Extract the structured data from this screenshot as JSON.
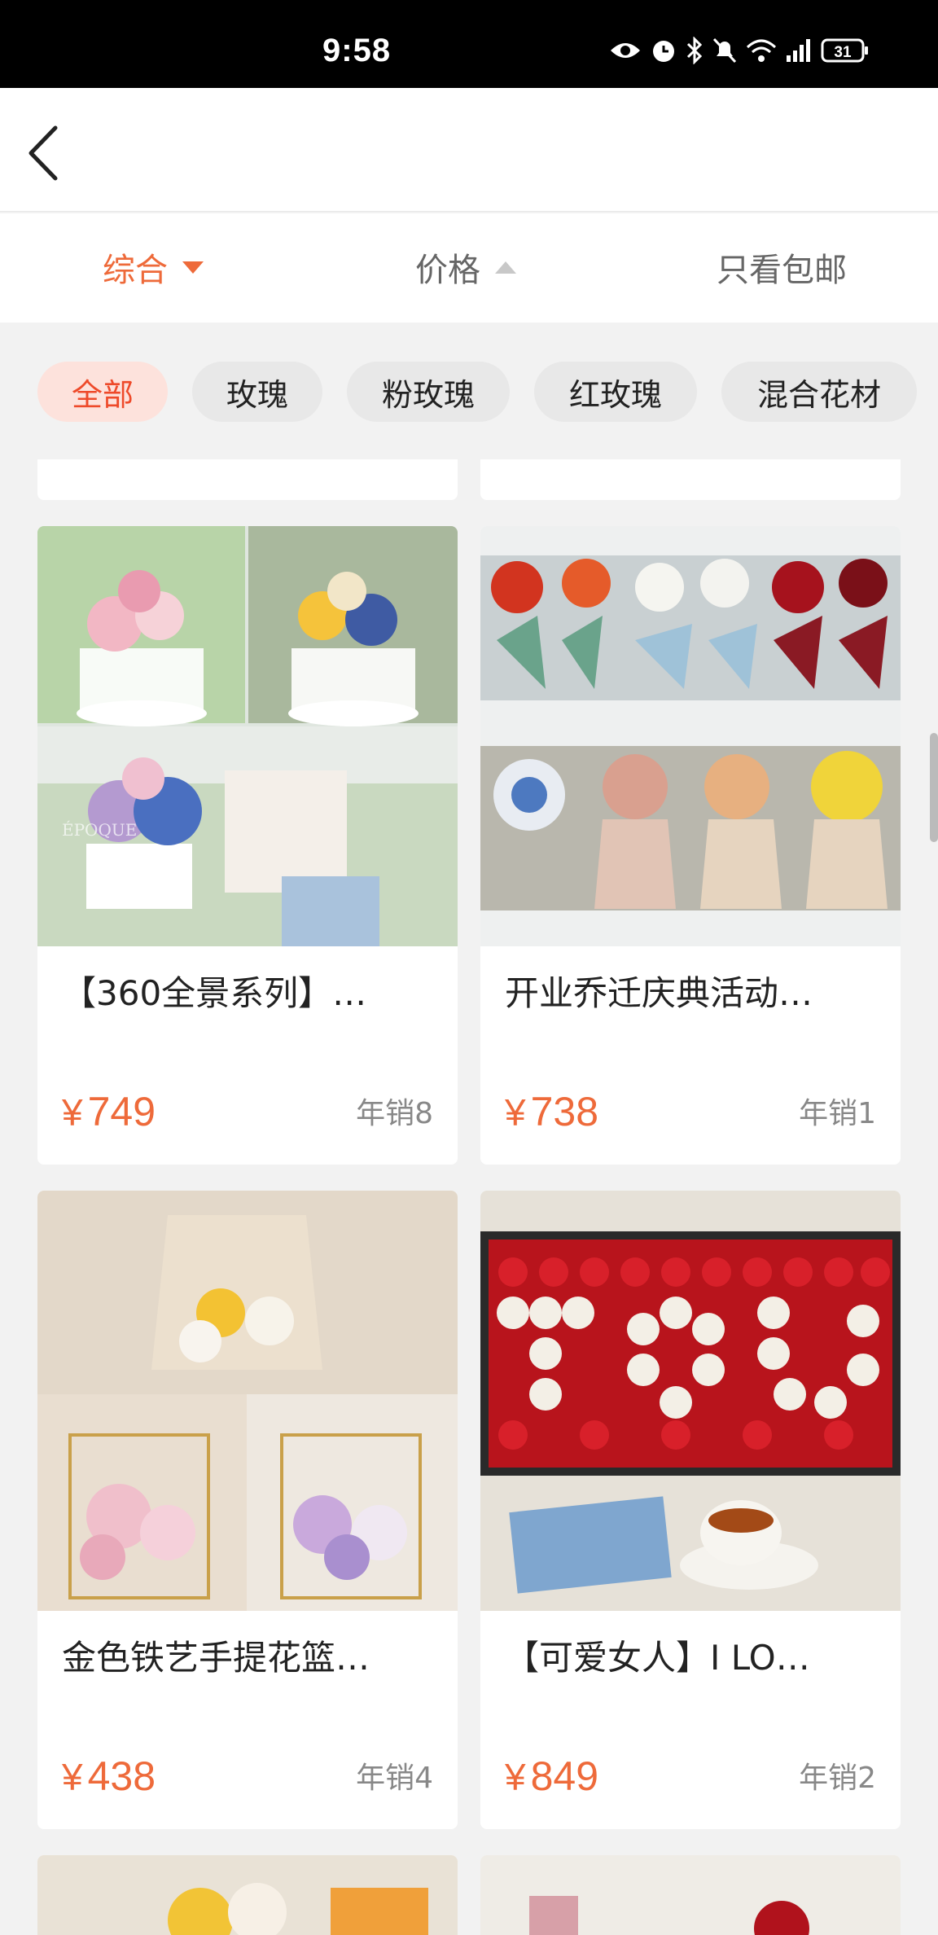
{
  "status_bar": {
    "time": "9:58",
    "battery": "31",
    "icons": [
      "eye-icon",
      "alarm-icon",
      "bluetooth-icon",
      "mute-icon",
      "wifi-icon",
      "signal-icon",
      "battery-icon"
    ]
  },
  "header": {
    "back_icon": "chevron-left-icon"
  },
  "sort_bar": {
    "items": [
      {
        "label": "综合",
        "active": true,
        "indicator": "triangle-down"
      },
      {
        "label": "价格",
        "active": false,
        "indicator": "triangle-up"
      },
      {
        "label": "只看包邮",
        "active": false
      }
    ]
  },
  "categories": [
    {
      "label": "全部",
      "active": true
    },
    {
      "label": "玫瑰",
      "active": false
    },
    {
      "label": "粉玫瑰",
      "active": false
    },
    {
      "label": "红玫瑰",
      "active": false
    },
    {
      "label": "混合花材",
      "active": false
    }
  ],
  "products": [
    {
      "title": "【360全景系列】…",
      "currency": "¥",
      "price": "749",
      "sales": "年销8"
    },
    {
      "title": "开业乔迁庆典活动…",
      "currency": "¥",
      "price": "738",
      "sales": "年销1"
    },
    {
      "title": "金色铁艺手提花篮…",
      "currency": "¥",
      "price": "438",
      "sales": "年销4"
    },
    {
      "title": "【可爱女人】I LO…",
      "currency": "¥",
      "price": "849",
      "sales": "年销2"
    }
  ],
  "colors": {
    "accent": "#ee6a3a",
    "chip_active_bg": "#fde2dc",
    "chip_bg": "#e8e8e8",
    "page_bg": "#f2f2f2"
  },
  "brand_watermark": "ÉPOQUE"
}
